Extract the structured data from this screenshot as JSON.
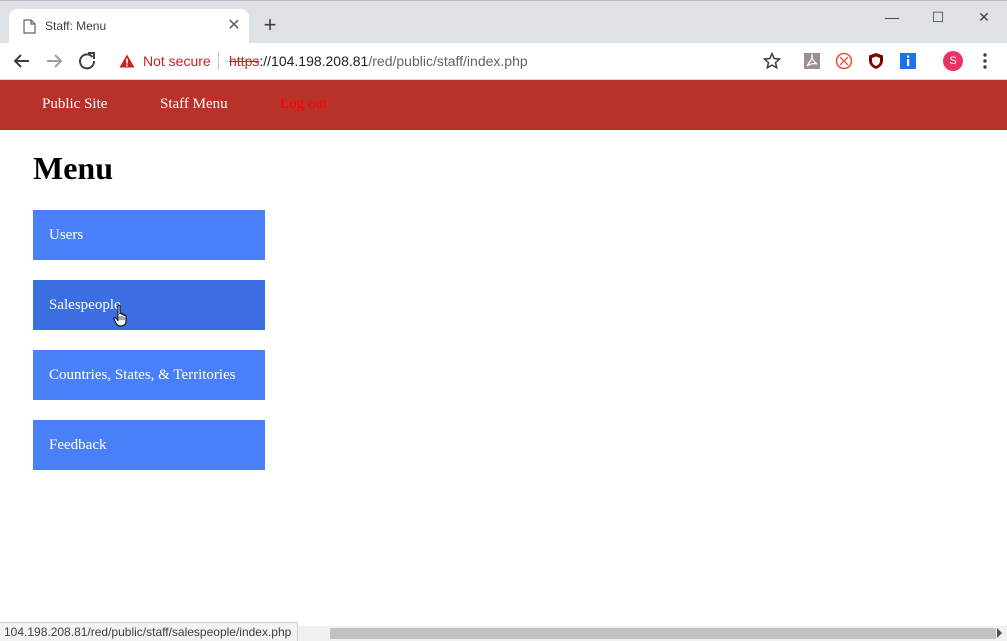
{
  "browser": {
    "tab": {
      "title": "Staff: Menu",
      "close_glyph": "✕",
      "icon": "page-icon"
    },
    "new_tab_glyph": "+",
    "window_controls": {
      "minimize": "—",
      "maximize": "☐",
      "close": "✕"
    },
    "address": {
      "security_label": "Not secure",
      "url_scheme": "https",
      "url_host": "://104.198.208.81",
      "url_path": "/red/public/staff/index.php"
    },
    "profile_initial": "S",
    "status_url": "104.198.208.81/red/public/staff/salespeople/index.php"
  },
  "colors": {
    "nav_bar": "#b8322a",
    "menu_button": "#4a7ffa",
    "menu_button_hover": "#3b6ee0",
    "logout_link": "#ff0000"
  },
  "site_nav": {
    "public_site": "Public Site",
    "staff_menu": "Staff Menu",
    "logout": "Log out"
  },
  "main": {
    "title": "Menu",
    "items": [
      {
        "label": "Users"
      },
      {
        "label": "Salespeople",
        "hovered": true
      },
      {
        "label": "Countries, States, & Territories"
      },
      {
        "label": "Feedback"
      }
    ]
  }
}
